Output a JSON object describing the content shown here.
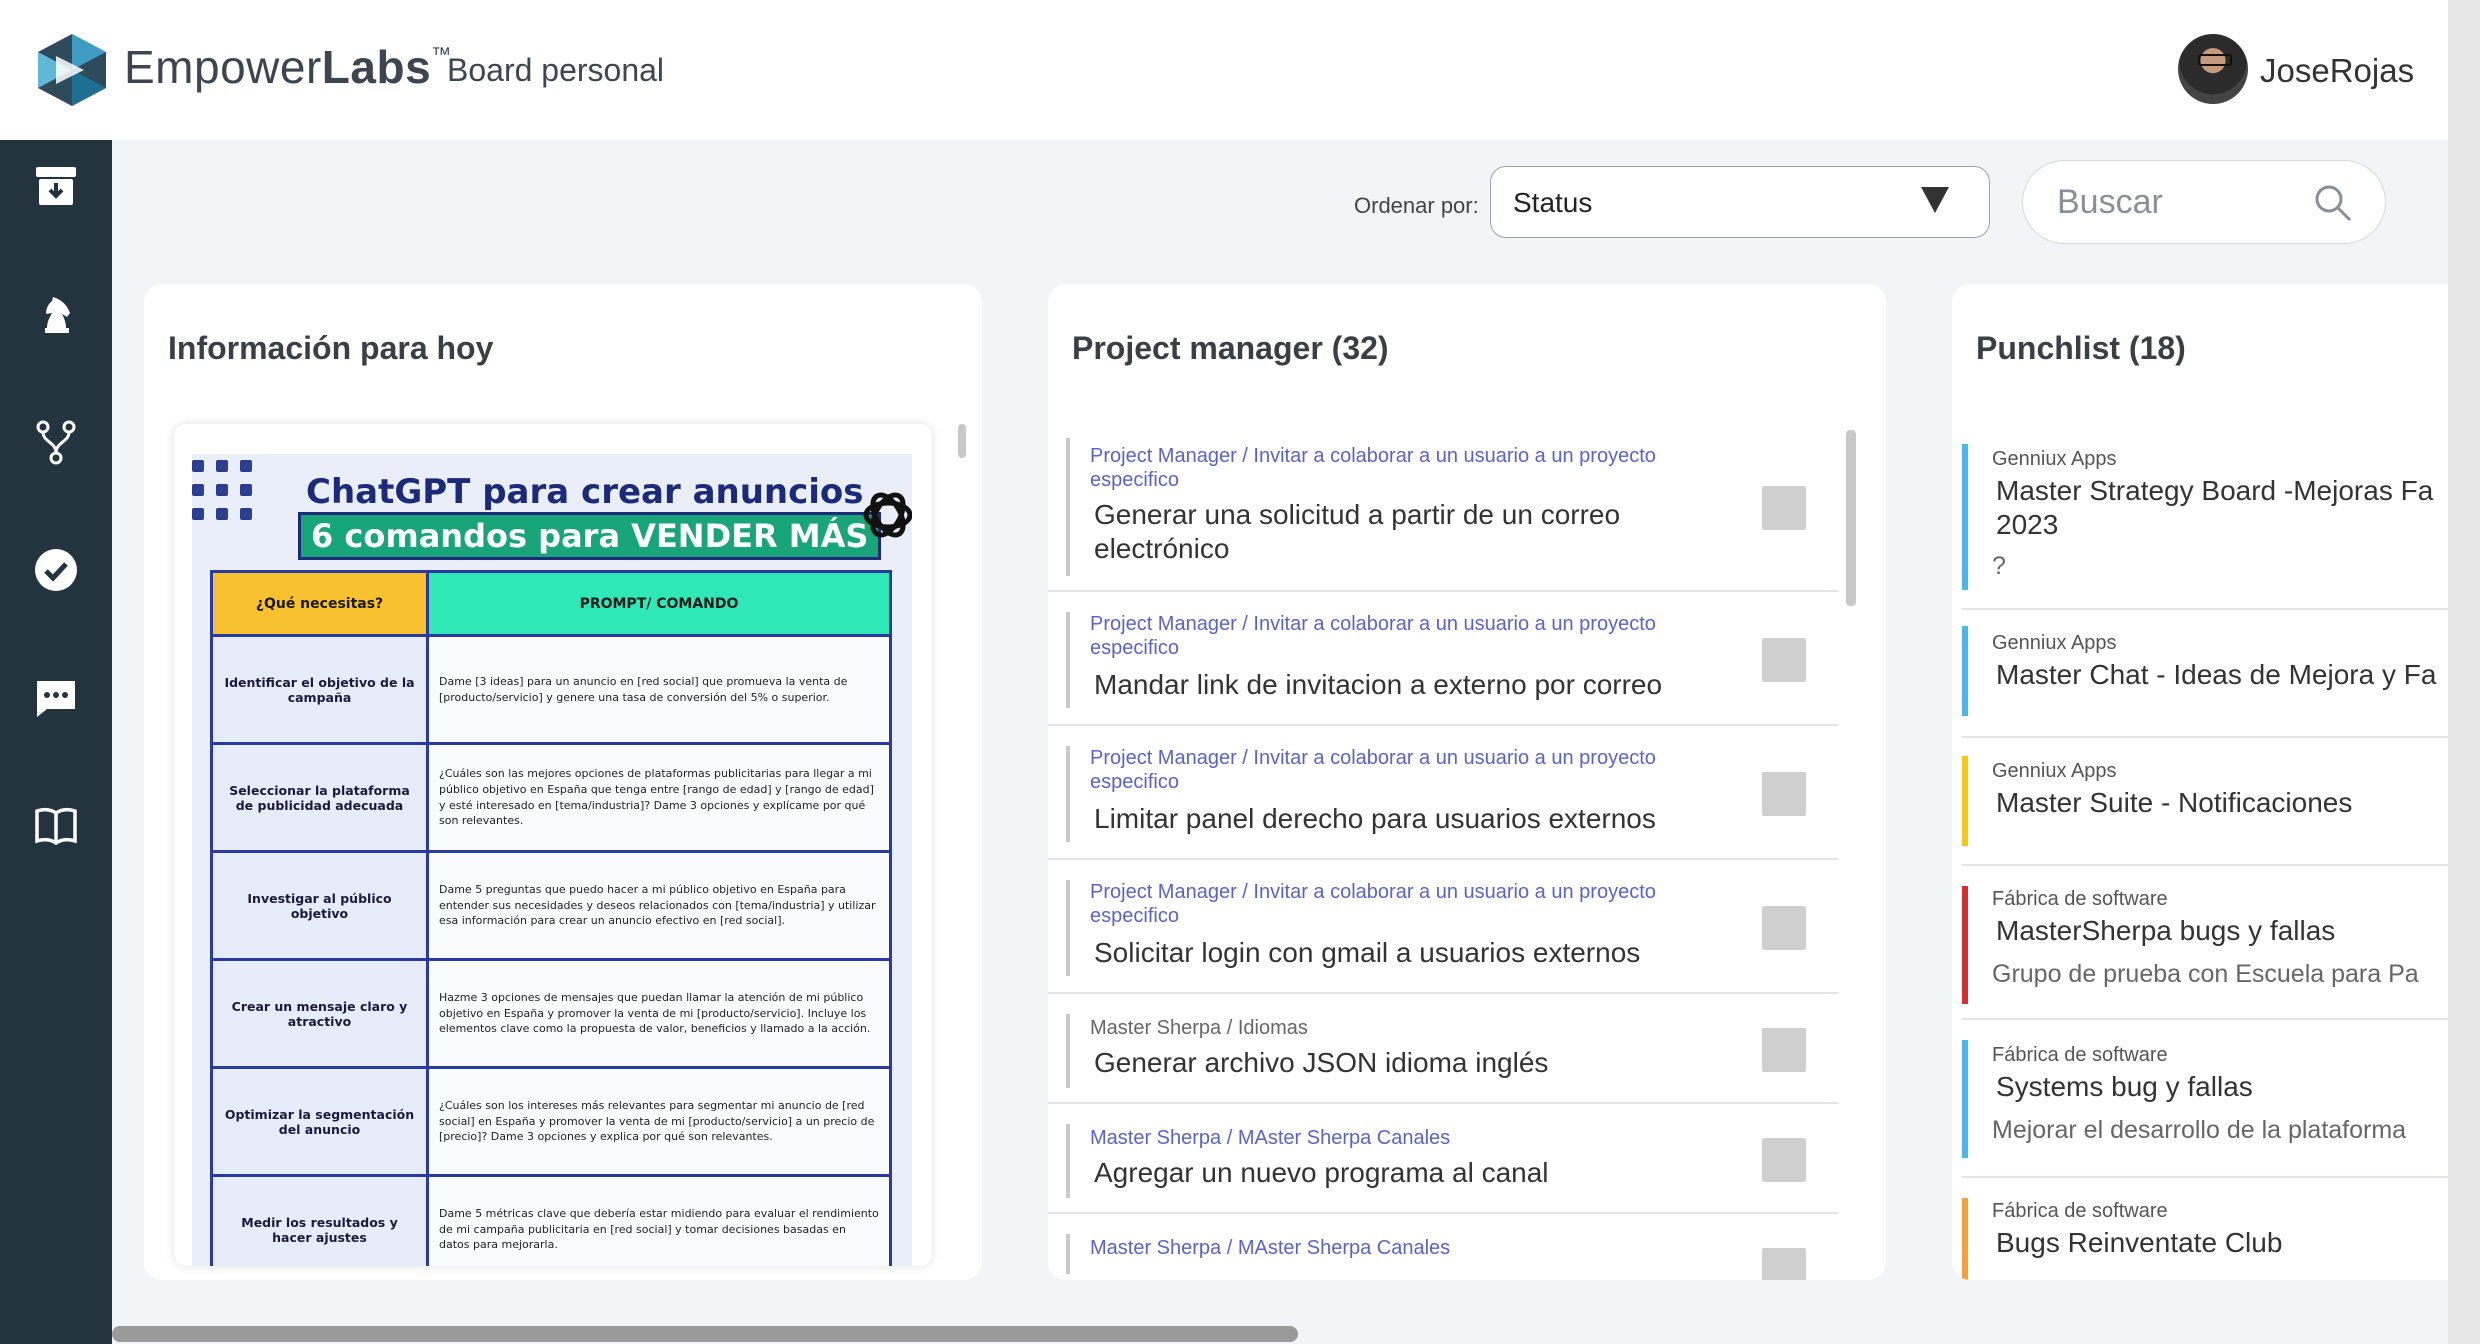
{
  "header": {
    "brand_first": "Empower",
    "brand_second": "Labs",
    "brand_tm": "™",
    "board_title": "Board personal",
    "username": "JoseRojas"
  },
  "sidebar": {
    "items": [
      {
        "icon": "archive-down-icon"
      },
      {
        "icon": "chess-knight-icon"
      },
      {
        "icon": "branch-fork-icon"
      },
      {
        "icon": "check-circle-icon"
      },
      {
        "icon": "chat-bubble-icon"
      },
      {
        "icon": "open-book-icon"
      }
    ]
  },
  "toolbar": {
    "sort_label": "Ordenar por:",
    "sort_value": "Status",
    "search_placeholder": "Buscar"
  },
  "columns": {
    "info": {
      "title": "Información para hoy",
      "poster": {
        "title_line1": "ChatGPT para crear anuncios",
        "title_line2": "6 comandos para VENDER MÁS",
        "col_need": "¿Qué necesitas?",
        "col_prompt": "PROMPT/ COMANDO",
        "rows": [
          {
            "need": "Identificar el objetivo de la campaña",
            "prompt": "Dame [3 ideas] para un anuncio en [red social] que promueva la venta de [producto/servicio] y genere una tasa de conversión del 5% o superior."
          },
          {
            "need": "Seleccionar la plataforma de publicidad adecuada",
            "prompt": "¿Cuáles son las mejores opciones de plataformas publicitarias para llegar a mi público objetivo en España que tenga entre [rango de edad] y [rango de edad] y esté interesado en [tema/industria]? Dame 3 opciones y explícame por qué son relevantes."
          },
          {
            "need": "Investigar al público objetivo",
            "prompt": "Dame 5 preguntas que puedo hacer a mi público objetivo en España para entender sus necesidades y deseos relacionados con [tema/industria] y utilizar esa información para crear un anuncio efectivo en [red social]."
          },
          {
            "need": "Crear un mensaje claro y atractivo",
            "prompt": "Hazme 3 opciones de mensajes que puedan llamar la atención de mi público objetivo en España y promover la venta de mi [producto/servicio]. Incluye los elementos clave como la propuesta de valor, beneficios y llamado a la acción."
          },
          {
            "need": "Optimizar la segmentación del anuncio",
            "prompt": "¿Cuáles son los intereses más relevantes para segmentar mi anuncio de [red social] en España y promover la venta de mi [producto/servicio] a un precio de [precio]? Dame 3 opciones y explica por qué son relevantes."
          },
          {
            "need": "Medir los resultados y hacer ajustes",
            "prompt": "Dame 5 métricas clave que debería estar midiendo para evaluar el rendimiento de mi campaña publicitaria en [red social] y tomar decisiones basadas en datos para mejorarla."
          }
        ]
      }
    },
    "pm": {
      "title": "Project manager (32)",
      "tasks": [
        {
          "path": "Project Manager / Invitar a colaborar a un usuario a un proyecto especifico",
          "name": "Generar una solicitud a partir de un correo electrónico"
        },
        {
          "path": "Project Manager / Invitar a colaborar a un usuario a un proyecto especifico",
          "name": "Mandar link de invitacion a externo por correo"
        },
        {
          "path": "Project Manager / Invitar a colaborar a un usuario a un proyecto especifico",
          "name": "Limitar panel derecho para usuarios externos"
        },
        {
          "path": "Project Manager / Invitar a colaborar a un usuario a un proyecto especifico",
          "name": "Solicitar login con gmail a usuarios externos"
        },
        {
          "path": "Master Sherpa / Idiomas",
          "name": "Generar archivo JSON idioma inglés"
        },
        {
          "path": "Master Sherpa / MAster Sherpa Canales",
          "name": "Agregar un nuevo programa al canal"
        },
        {
          "path": "Master Sherpa / MAster Sherpa Canales",
          "name": ""
        }
      ]
    },
    "punch": {
      "title": "Punchlist (18)",
      "items": [
        {
          "company": "Genniux Apps",
          "name": "Master Strategy Board -Mejoras Fa",
          "name2": "2023",
          "desc": "?",
          "color": "#4bb6e8"
        },
        {
          "company": "Genniux Apps",
          "name": "Master Chat - Ideas de Mejora y Fa",
          "desc": "",
          "color": "#4bb6e8"
        },
        {
          "company": "Genniux Apps",
          "name": "Master Suite - Notificaciones",
          "desc": "",
          "color": "#f5c518"
        },
        {
          "company": "Fábrica de software",
          "name": "MasterSherpa bugs y fallas",
          "desc": "Grupo de prueba con Escuela para Pa",
          "color": "#d32f2f"
        },
        {
          "company": "Fábrica de software",
          "name": "Systems bug y fallas",
          "desc": "Mejorar el desarrollo de la plataforma",
          "color": "#4bb6e8"
        },
        {
          "company": "Fábrica de software",
          "name": "Bugs Reinventate Club",
          "desc": "",
          "color": "#f5a03a"
        }
      ]
    }
  }
}
